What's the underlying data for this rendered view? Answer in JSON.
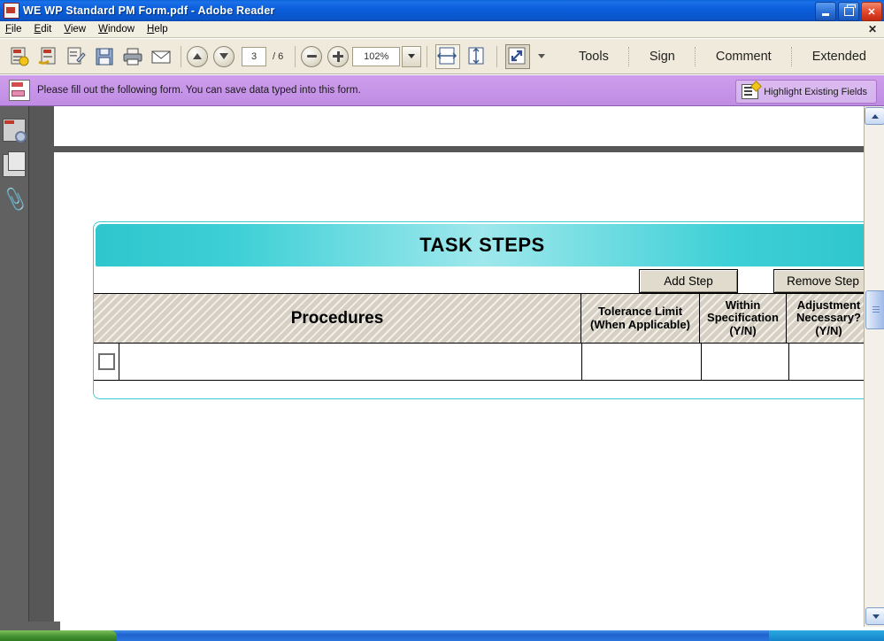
{
  "window": {
    "title": "WE WP Standard PM Form.pdf - Adobe Reader",
    "app_icon": "pdf-document-icon",
    "minimize_label": "",
    "restore_label": "",
    "close_label": "✕"
  },
  "menu": {
    "items": [
      {
        "label": "File",
        "accel": "F"
      },
      {
        "label": "Edit",
        "accel": "E"
      },
      {
        "label": "View",
        "accel": "V"
      },
      {
        "label": "Window",
        "accel": "W"
      },
      {
        "label": "Help",
        "accel": "H"
      }
    ],
    "close_doc_label": "✕"
  },
  "toolbar": {
    "icons": [
      {
        "name": "create-pdf-icon"
      },
      {
        "name": "export-pdf-icon"
      },
      {
        "name": "edit-pdf-icon"
      },
      {
        "name": "save-file-icon"
      },
      {
        "name": "print-icon"
      },
      {
        "name": "email-icon"
      }
    ],
    "previous_page_icon": "arrow-up-icon",
    "next_page_icon": "arrow-down-icon",
    "page_number": "3",
    "page_total": "/ 6",
    "zoom_out_icon": "minus-circle-icon",
    "zoom_in_icon": "plus-circle-icon",
    "zoom_value": "102%",
    "zoom_dropdown_icon": "chevron-down-icon",
    "fit_width_icon": "fit-width-icon",
    "fit_page_icon": "fit-page-icon",
    "marquee_zoom_icon": "marquee-zoom-icon",
    "overflow_icon": "toolbar-overflow-icon",
    "panels": [
      {
        "label": "Tools"
      },
      {
        "label": "Sign"
      },
      {
        "label": "Comment"
      },
      {
        "label": "Extended"
      }
    ]
  },
  "form_bar": {
    "icon": "form-document-icon",
    "message": "Please fill out the following form. You can save data typed into this form.",
    "highlight_button": {
      "label": "Highlight Existing Fields",
      "icon": "highlight-fields-icon"
    }
  },
  "sidebar": {
    "items": [
      {
        "name": "page-thumbnails-icon",
        "label": ""
      },
      {
        "name": "pages-panel-icon",
        "label": ""
      },
      {
        "name": "attachments-paperclip-icon",
        "label": ""
      }
    ]
  },
  "document": {
    "section_title": "TASK STEPS",
    "buttons": {
      "add_step": "Add Step",
      "remove_step": "Remove Step"
    },
    "table": {
      "headers": {
        "procedures": "Procedures",
        "tolerance_line1": "Tolerance Limit",
        "tolerance_line2": "(When Applicable)",
        "within_line1": "Within",
        "within_line2": "Specification",
        "within_line3": "(Y/N)",
        "adjustment_line1": "Adjustment",
        "adjustment_line2": "Necessary?",
        "adjustment_line3": "(Y/N)"
      },
      "rows": [
        {
          "checkbox": "unchecked",
          "procedures": "",
          "tolerance": "",
          "within_specification": "",
          "adjustment_necessary": ""
        }
      ]
    }
  },
  "scrollbar": {
    "up_icon": "scroll-up-icon",
    "down_icon": "scroll-down-icon",
    "thumb": "scroll-thumb"
  },
  "colors": {
    "banner_teal": "#3dd0d6",
    "banner_teal_light": "#9fe8ec",
    "table_border": "#3ec8d4",
    "hatch_fill": "#d6cfc4",
    "form_bar_purple": "#c795e8",
    "titlebar_blue": "#0b5ddb",
    "button_face": "#e0dbcc"
  }
}
